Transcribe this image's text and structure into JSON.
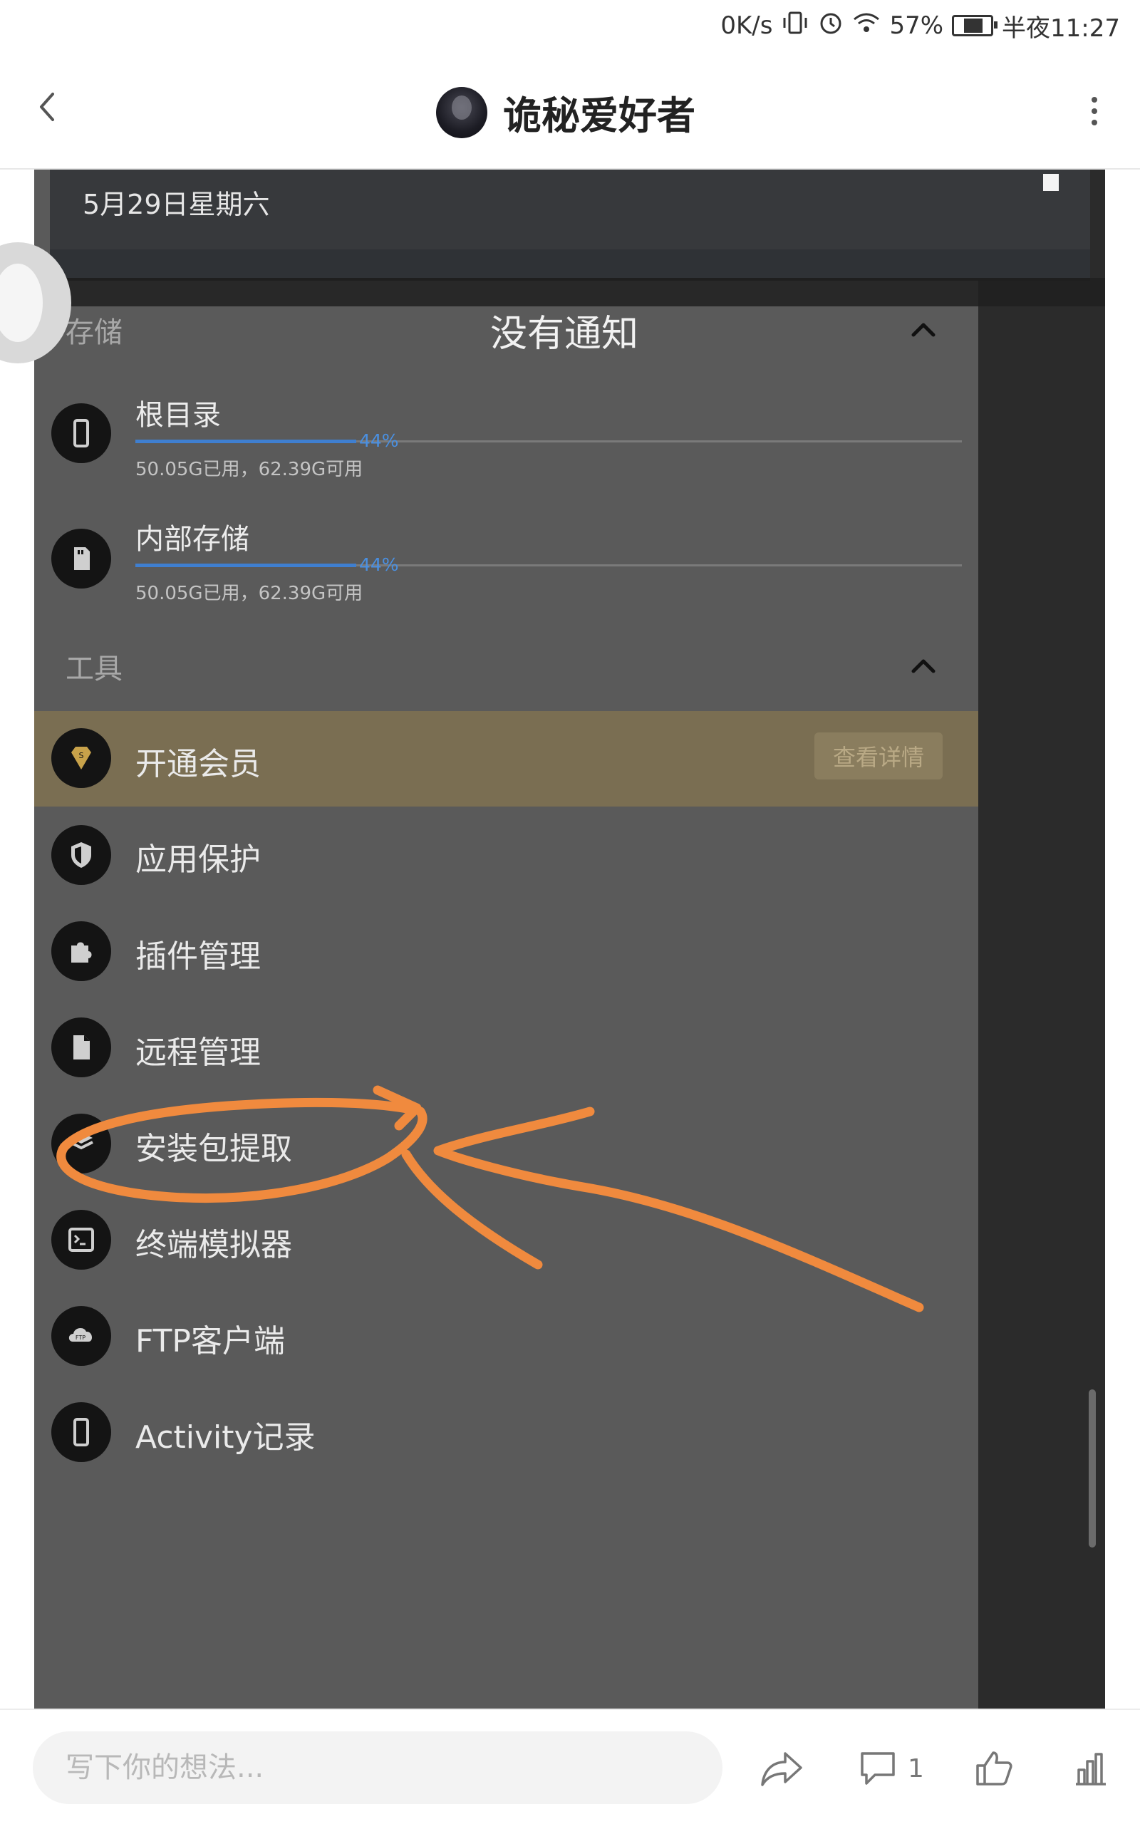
{
  "status_bar": {
    "speed": "0K/s",
    "battery_pct": "57%",
    "time": "半夜11:27",
    "icons": [
      "vibrate-icon",
      "alarm-icon",
      "wifi-icon",
      "battery-icon"
    ]
  },
  "header": {
    "title": "诡秘爱好者",
    "back_icon": "chevron-left-icon",
    "more_icon": "more-vertical-icon"
  },
  "embedded": {
    "notification_date": "5月29日星期六",
    "no_notification": "没有通知",
    "storage_section": "存储",
    "storage": [
      {
        "name": "根目录",
        "usage": "50.05G已用，62.39G可用",
        "percent_label": "44%",
        "percent": 44,
        "icon": "phone-icon"
      },
      {
        "name": "内部存储",
        "usage": "50.05G已用，62.39G可用",
        "percent_label": "44%",
        "percent": 44,
        "icon": "sd-card-icon"
      }
    ],
    "tools_section": "工具",
    "vip": {
      "label": "开通会员",
      "button": "查看详情",
      "icon": "vip-diamond-icon"
    },
    "tools": [
      {
        "label": "应用保护",
        "icon": "shield-icon"
      },
      {
        "label": "插件管理",
        "icon": "puzzle-icon"
      },
      {
        "label": "远程管理",
        "icon": "document-icon"
      },
      {
        "label": "安装包提取",
        "icon": "package-icon"
      },
      {
        "label": "终端模拟器",
        "icon": "terminal-icon"
      },
      {
        "label": "FTP客户端",
        "icon": "cloud-ftp-icon"
      },
      {
        "label": "Activity记录",
        "icon": "phone-icon"
      }
    ]
  },
  "bottom_bar": {
    "comment_placeholder": "写下你的想法...",
    "comment_count": "1",
    "icons": [
      "share-icon",
      "comment-icon",
      "like-icon",
      "stats-icon"
    ]
  },
  "colors": {
    "annotation": "#f08a3e",
    "progress": "#3f7fd0"
  }
}
